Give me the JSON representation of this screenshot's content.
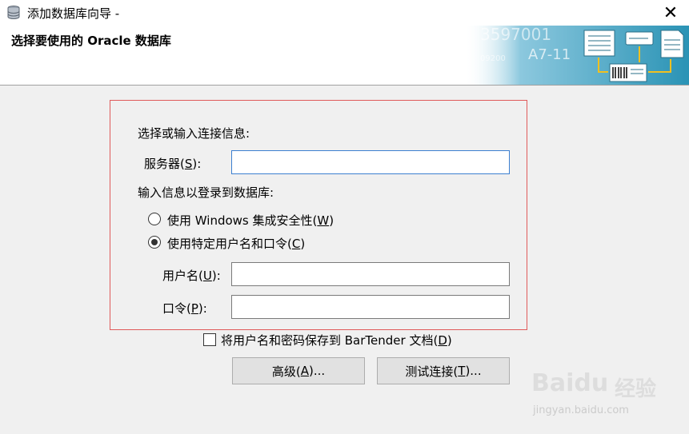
{
  "window": {
    "title": "添加数据库向导 -",
    "close_symbol": "✕",
    "icon": "database-icon"
  },
  "header": {
    "title": "选择要使用的 Oracle 数据库",
    "banner_text_1": "3597001",
    "banner_text_2": "A7-11",
    "banner_text_3": "09200"
  },
  "form": {
    "connection_label": "选择或输入连接信息:",
    "server": {
      "label": "服务器(",
      "accel": "S",
      "suffix": "):",
      "value": ""
    },
    "login_label": "输入信息以登录到数据库:",
    "auth_options": [
      {
        "label": "使用 Windows 集成安全性(",
        "accel": "W",
        "suffix": ")",
        "selected": false
      },
      {
        "label": "使用特定用户名和口令(",
        "accel": "C",
        "suffix": ")",
        "selected": true
      }
    ],
    "username": {
      "label": "用户名(",
      "accel": "U",
      "suffix": "):",
      "value": ""
    },
    "password": {
      "label": "口令(",
      "accel": "P",
      "suffix": "):",
      "value": ""
    }
  },
  "save_credentials": {
    "label": "将用户名和密码保存到 BarTender 文档(",
    "accel": "D",
    "suffix": ")",
    "checked": false
  },
  "buttons": {
    "advanced": {
      "label": "高级(",
      "accel": "A",
      "suffix": ")..."
    },
    "test": {
      "label": "测试连接(",
      "accel": "T",
      "suffix": ")..."
    }
  },
  "watermark": {
    "brand": "Bai",
    "brand2": "du",
    "brand_cn": "经验",
    "url": "jingyan.baidu.com"
  },
  "colors": {
    "highlight_border": "#e05a5a",
    "focus_border": "#3c7fd0",
    "banner_teal": "#2a93b5"
  }
}
